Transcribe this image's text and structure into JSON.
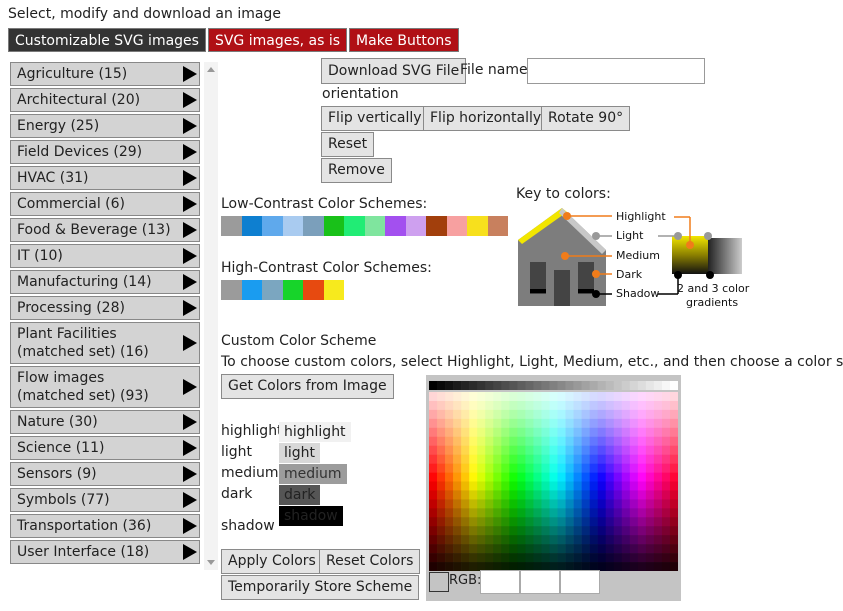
{
  "header": {
    "title": "Select, modify and download an image"
  },
  "tabs": [
    {
      "label": "Customizable SVG images"
    },
    {
      "label": "SVG images, as is"
    },
    {
      "label": "Make Buttons"
    }
  ],
  "categories": [
    "Agriculture (15)",
    "Architectural (20)",
    "Energy (25)",
    "Field Devices (29)",
    "HVAC (31)",
    "Commercial (6)",
    "Food & Beverage (13)",
    "IT (10)",
    "Manufacturing (14)",
    "Processing (28)",
    "Plant Facilities (matched set) (16)",
    "Flow images (matched set) (93)",
    "Nature (30)",
    "Science (11)",
    "Sensors (9)",
    "Symbols (77)",
    "Transportation (36)",
    "User Interface (18)"
  ],
  "controls": {
    "download_label": "Download SVG File",
    "filename_label": "File name:",
    "filename_value": "",
    "orientation_label": "orientation",
    "flip_v": "Flip vertically",
    "flip_h": "Flip horizontally",
    "rotate": "Rotate 90°",
    "reset": "Reset",
    "remove": "Remove"
  },
  "schemes": {
    "low_label": "Low-Contrast Color Schemes:",
    "low_colors": [
      "#9b9b9b",
      "#0e7fd0",
      "#5fa9ec",
      "#a9cbf0",
      "#7b9fbb",
      "#19c119",
      "#21ec75",
      "#7fe59e",
      "#a350ef",
      "#cea0ef",
      "#a23f0c",
      "#f7a0a0",
      "#f7e01d",
      "#c8805e"
    ],
    "high_label": "High-Contrast Color Schemes:",
    "high_colors": [
      "#9b9b9b",
      "#1a9cf0",
      "#7ba6c0",
      "#17d42a",
      "#e74a10",
      "#f7ea1d"
    ]
  },
  "key": {
    "title": "Key to colors:",
    "highlight": "Highlight",
    "light": "Light",
    "medium": "Medium",
    "dark": "Dark",
    "shadow": "Shadow",
    "gradients_line1": "2 and 3 color",
    "gradients_line2": "gradients"
  },
  "custom": {
    "title": "Custom Color Scheme",
    "instructions": "To choose custom colors, select Highlight, Light, Medium, etc., and then choose a color swatch",
    "get_colors": "Get Colors from Image",
    "rows": [
      {
        "label": "highlight",
        "swatch_text": "highlight",
        "bg": "#f1f1f1",
        "fg": "#222"
      },
      {
        "label": "light",
        "swatch_text": "light",
        "bg": "#d8d8d8",
        "fg": "#222"
      },
      {
        "label": "medium",
        "swatch_text": "medium",
        "bg": "#9c9c9c",
        "fg": "#333"
      },
      {
        "label": "dark",
        "swatch_text": "dark",
        "bg": "#555555",
        "fg": "#222"
      },
      {
        "label": "shadow",
        "swatch_text": "shadow",
        "bg": "#000000",
        "fg": "#222"
      }
    ],
    "apply": "Apply Colors",
    "reset_colors": "Reset Colors",
    "store": "Temporarily Store Scheme"
  },
  "palette": {
    "rgb_label": "RGB:"
  }
}
